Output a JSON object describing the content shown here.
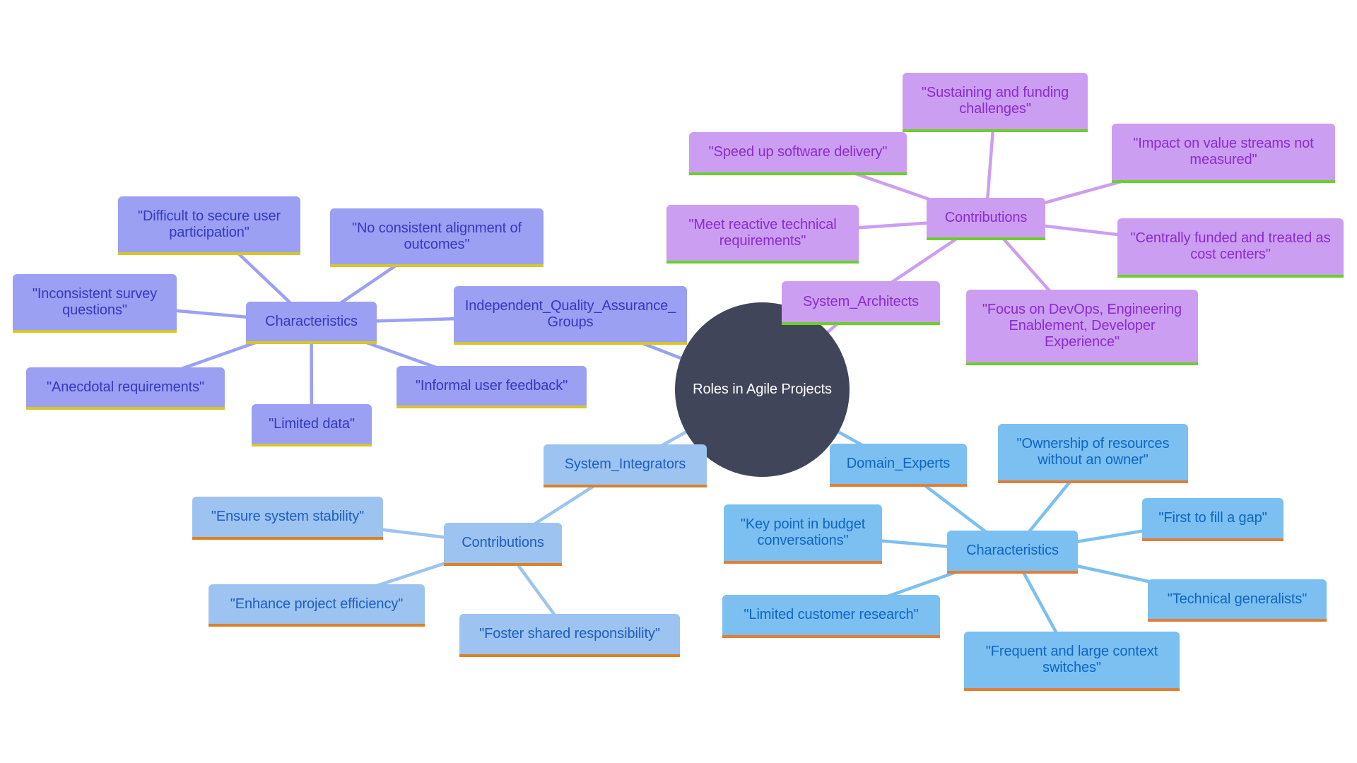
{
  "diagram": {
    "type": "mindmap",
    "root": {
      "id": "root",
      "label": "Roles in Agile Projects",
      "color": "#414559",
      "text_color": "#ffffff"
    },
    "branches": {
      "iqa": {
        "fill": "#9ca0f2",
        "text": "#3538c2",
        "accent": "#d6c62a",
        "edge": "#9ca0f2"
      },
      "sa": {
        "fill": "#cc9ef1",
        "text": "#8b2bd0",
        "accent": "#6bcf2c",
        "edge": "#cc9ef1"
      },
      "si": {
        "fill": "#9dc3f0",
        "text": "#1f5ec0",
        "accent": "#d8822a",
        "edge": "#9dc3f0"
      },
      "de": {
        "fill": "#7cbff1",
        "text": "#0f66c2",
        "accent": "#e08036",
        "edge": "#7cbff1"
      }
    },
    "nodes": {
      "iqa": {
        "label": "Independent_Quality_Assurance_Groups",
        "parent": "root",
        "branch": "iqa"
      },
      "iqa-characteristics": {
        "label": "Characteristics",
        "parent": "iqa",
        "branch": "iqa"
      },
      "iqa-difficult": {
        "label": "\"Difficult to secure user participation\"",
        "parent": "iqa-characteristics",
        "branch": "iqa"
      },
      "iqa-no-consistent": {
        "label": "\"No consistent alignment of outcomes\"",
        "parent": "iqa-characteristics",
        "branch": "iqa"
      },
      "iqa-inconsistent": {
        "label": "\"Inconsistent survey questions\"",
        "parent": "iqa-characteristics",
        "branch": "iqa"
      },
      "iqa-anecdotal": {
        "label": "\"Anecdotal requirements\"",
        "parent": "iqa-characteristics",
        "branch": "iqa"
      },
      "iqa-limited-data": {
        "label": "\"Limited data\"",
        "parent": "iqa-characteristics",
        "branch": "iqa"
      },
      "iqa-informal": {
        "label": "\"Informal user feedback\"",
        "parent": "iqa-characteristics",
        "branch": "iqa"
      },
      "sa": {
        "label": "System_Architects",
        "parent": "root",
        "branch": "sa"
      },
      "sa-contributions": {
        "label": "Contributions",
        "parent": "sa",
        "branch": "sa"
      },
      "sa-sustaining": {
        "label": "\"Sustaining and funding challenges\"",
        "parent": "sa-contributions",
        "branch": "sa"
      },
      "sa-speed": {
        "label": "\"Speed up software delivery\"",
        "parent": "sa-contributions",
        "branch": "sa"
      },
      "sa-impact": {
        "label": "\"Impact on value streams not measured\"",
        "parent": "sa-contributions",
        "branch": "sa"
      },
      "sa-meet": {
        "label": "\"Meet reactive technical requirements\"",
        "parent": "sa-contributions",
        "branch": "sa"
      },
      "sa-centrally": {
        "label": "\"Centrally funded and treated as cost centers\"",
        "parent": "sa-contributions",
        "branch": "sa"
      },
      "sa-focus": {
        "label": "\"Focus on DevOps, Engineering Enablement, Developer Experience\"",
        "parent": "sa-contributions",
        "branch": "sa"
      },
      "si": {
        "label": "System_Integrators",
        "parent": "root",
        "branch": "si"
      },
      "si-contributions": {
        "label": "Contributions",
        "parent": "si",
        "branch": "si"
      },
      "si-ensure": {
        "label": "\"Ensure system stability\"",
        "parent": "si-contributions",
        "branch": "si"
      },
      "si-enhance": {
        "label": "\"Enhance project efficiency\"",
        "parent": "si-contributions",
        "branch": "si"
      },
      "si-foster": {
        "label": "\"Foster shared responsibility\"",
        "parent": "si-contributions",
        "branch": "si"
      },
      "de": {
        "label": "Domain_Experts",
        "parent": "root",
        "branch": "de"
      },
      "de-characteristics": {
        "label": "Characteristics",
        "parent": "de",
        "branch": "de"
      },
      "de-ownership": {
        "label": "\"Ownership of resources without an owner\"",
        "parent": "de-characteristics",
        "branch": "de"
      },
      "de-first": {
        "label": "\"First to fill a gap\"",
        "parent": "de-characteristics",
        "branch": "de"
      },
      "de-key": {
        "label": "\"Key point in budget conversations\"",
        "parent": "de-characteristics",
        "branch": "de"
      },
      "de-technical": {
        "label": "\"Technical generalists\"",
        "parent": "de-characteristics",
        "branch": "de"
      },
      "de-limited-customer": {
        "label": "\"Limited customer research\"",
        "parent": "de-characteristics",
        "branch": "de"
      },
      "de-frequent": {
        "label": "\"Frequent and large context switches\"",
        "parent": "de-characteristics",
        "branch": "de"
      }
    }
  }
}
